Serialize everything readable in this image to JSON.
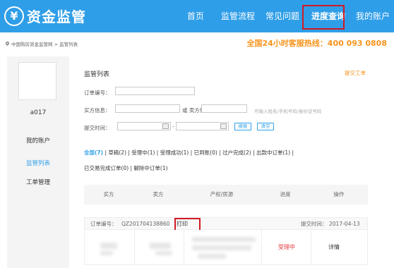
{
  "logo": {
    "symbol": "¥",
    "title": "资金监管"
  },
  "nav": {
    "items": [
      {
        "label": "首页",
        "active": false
      },
      {
        "label": "监管流程",
        "active": false
      },
      {
        "label": "常见问题",
        "active": false
      },
      {
        "label": "进度查询",
        "active": true
      },
      {
        "label": "我的账户",
        "active": false
      }
    ]
  },
  "breadcrumb": "中国购房资金监管网 > 监管列表",
  "hotline": "全国24小时客服热线：400 093 0808",
  "sidebar": {
    "username": "a017",
    "items": [
      {
        "label": "我的账户",
        "active": false
      },
      {
        "label": "监管列表",
        "active": true
      },
      {
        "label": "工单管理",
        "active": false
      }
    ]
  },
  "main": {
    "title": "监管列表",
    "submit_ticket": "提交工单",
    "search": {
      "order_label": "订单编号：",
      "buyer_label": "买方信息：",
      "or_seller_label": "或 卖方信息：",
      "hint": "可输入姓名/手机号码/身份证号码",
      "time_label": "提交时间：",
      "dash": "-",
      "search_button": "搜索",
      "clear_button": "清空"
    },
    "filters": [
      {
        "label": "全部(7)",
        "active": true
      },
      {
        "label": "草稿(2)",
        "active": false
      },
      {
        "label": "受理中(1)",
        "active": false
      },
      {
        "label": "受理成功(1)",
        "active": false
      },
      {
        "label": "已到账(0)",
        "active": false
      },
      {
        "label": "过户完成(2)",
        "active": false
      },
      {
        "label": "出款中订单(1)",
        "active": false
      },
      {
        "label": "已交易完成订单(0)",
        "active": false
      },
      {
        "label": "解除中订单(1)",
        "active": false
      }
    ],
    "table": {
      "columns": [
        "买方",
        "卖方",
        "产权/房源",
        "进度",
        "操作"
      ]
    },
    "order": {
      "no_label": "订单编号：",
      "no_value": "QZ201704138860",
      "print_label": "打印",
      "date_label": "提交时间：",
      "date_value": "2017-04-13",
      "status": "受理中",
      "action": "详情"
    }
  },
  "colors": {
    "header_bg": "#2f9ee8",
    "accent": "#2f9ee8",
    "hotline": "#f7941d",
    "highlight_box": "#d11a23",
    "status_red": "#e8383d"
  }
}
